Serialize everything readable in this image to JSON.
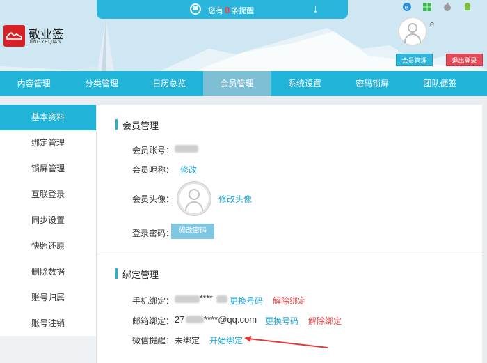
{
  "header": {
    "notice_prefix": "您有",
    "notice_count": "0",
    "notice_suffix": "条提醒",
    "brand": "敬业签",
    "brand_sub": "JINGYEQIAN",
    "user_name": "e",
    "member_button": "会员管理",
    "logout_button": "退出登录",
    "os_icons": [
      "ie-icon",
      "windows-icon",
      "apple-icon",
      "android-icon"
    ]
  },
  "nav": {
    "items": [
      "内容管理",
      "分类管理",
      "日历总览",
      "会员管理",
      "系统设置",
      "密码锁屏",
      "团队便签"
    ],
    "active_index": 3
  },
  "sidebar": {
    "items": [
      "基本资料",
      "绑定管理",
      "锁屏管理",
      "互联登录",
      "同步设置",
      "快照还原",
      "删除数据",
      "账号归属",
      "账号注销"
    ],
    "active_index": 0
  },
  "member": {
    "title": "会员管理",
    "account_label": "会员账号：",
    "nickname_label": "会员昵称：",
    "nickname_edit": "修改",
    "avatar_label": "会员头像：",
    "avatar_edit": "修改头像",
    "password_label": "登录密码：",
    "password_button": "修改密码"
  },
  "binding": {
    "title": "绑定管理",
    "phone_label": "手机绑定：",
    "phone_value": "****",
    "phone_change": "更换号码",
    "phone_unbind": "解除绑定",
    "email_label": "邮箱绑定：",
    "email_prefix": "27",
    "email_suffix": "****@qq.com",
    "email_change": "更换号码",
    "email_unbind": "解除绑定",
    "wechat_label": "微信提醒：",
    "wechat_status": "未绑定",
    "wechat_bind": "开始绑定"
  },
  "colors": {
    "accent": "#22b3d9",
    "danger": "#e24a4a",
    "link": "#22a8d4"
  }
}
